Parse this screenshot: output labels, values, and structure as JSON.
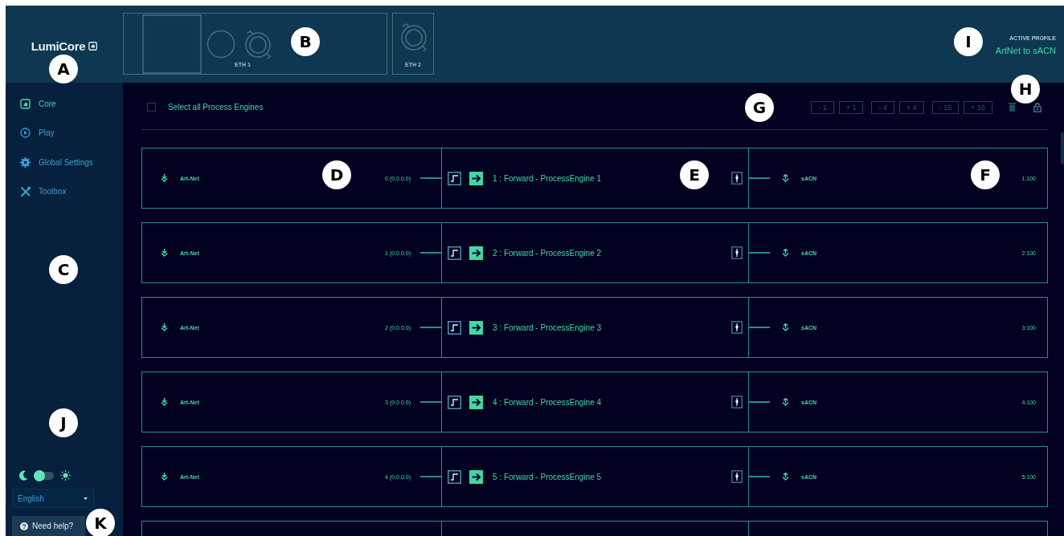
{
  "header": {
    "logo": "LumiCore",
    "ports": [
      {
        "label": "ETH 1",
        "kind": "main"
      },
      {
        "label": "ETH 2",
        "kind": "single"
      }
    ],
    "active_profile": {
      "label": "ACTIVE PROFILE",
      "value": "ArtNet to sACN"
    }
  },
  "sidebar": {
    "items": [
      {
        "label": "Core",
        "kind": "core",
        "selected": true
      },
      {
        "label": "Play",
        "kind": "play",
        "selected": false
      },
      {
        "label": "Global Settings",
        "kind": "gear",
        "selected": false
      },
      {
        "label": "Toolbox",
        "kind": "tools",
        "selected": false
      }
    ],
    "theme_toggle": {
      "on": false
    },
    "language": {
      "value": "English"
    },
    "help": "Need help?"
  },
  "toolbar": {
    "select_all": {
      "label": "Select all Process Engines",
      "checked": false
    },
    "steps": [
      "- 1",
      "+ 1",
      "- 4",
      "+ 4",
      "- 16",
      "+ 16"
    ]
  },
  "rows": [
    {
      "kind": "full",
      "input": "Art-Net",
      "input_address": "0 (0.0.0.0)",
      "engine": "1 : Forward - ProcessEngine 1",
      "output": "sACN",
      "output_address": "1:100"
    },
    {
      "kind": "full",
      "input": "Art-Net",
      "input_address": "1 (0.0.0.0)",
      "engine": "2 : Forward - ProcessEngine 2",
      "output": "sACN",
      "output_address": "2:100"
    },
    {
      "kind": "full",
      "input": "Art-Net",
      "input_address": "2 (0.0.0.0)",
      "engine": "3 : Forward - ProcessEngine 3",
      "output": "sACN",
      "output_address": "3:100"
    },
    {
      "kind": "full",
      "input": "Art-Net",
      "input_address": "3 (0.0.0.0)",
      "engine": "4 : Forward - ProcessEngine 4",
      "output": "sACN",
      "output_address": "4:100"
    },
    {
      "kind": "full",
      "input": "Art-Net",
      "input_address": "4 (0.0.0.0)",
      "engine": "5 : Forward - ProcessEngine 5",
      "output": "sACN",
      "output_address": "5:100"
    },
    {
      "kind": "partial"
    }
  ],
  "callouts": [
    "A",
    "B",
    "C",
    "D",
    "E",
    "F",
    "G",
    "H",
    "I",
    "J",
    "K"
  ]
}
